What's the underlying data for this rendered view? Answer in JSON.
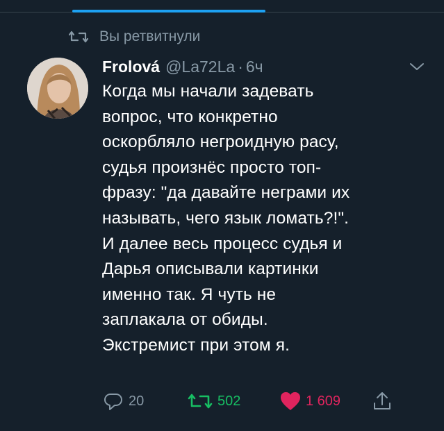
{
  "retweet_context": {
    "label": "Вы ретвитнули",
    "icon": "retweet-icon"
  },
  "tweet": {
    "display_name": "Frolová",
    "handle": "@La72La",
    "separator": "·",
    "time": "6ч",
    "text": "Когда мы начали задевать\nвопрос, что конкретно\nоскорбляло негроидную расу,\nсудья произнёс просто топ-\nфразу: \"да давайте неграми их\nназывать, чего язык ломать?!\".\nИ далее весь процесс судья и\nДарья описывали картинки\nименно так. Я чуть не\nзаплакала от обиды.\nЭкстремист при этом я."
  },
  "actions": {
    "reply_count": "20",
    "retweet_count": "502",
    "like_count": "1 609"
  },
  "colors": {
    "background": "#15202b",
    "secondary_text": "#8899a6",
    "accent": "#1da1f2",
    "retweet_active": "#17bf63",
    "like_active": "#e0245e"
  }
}
